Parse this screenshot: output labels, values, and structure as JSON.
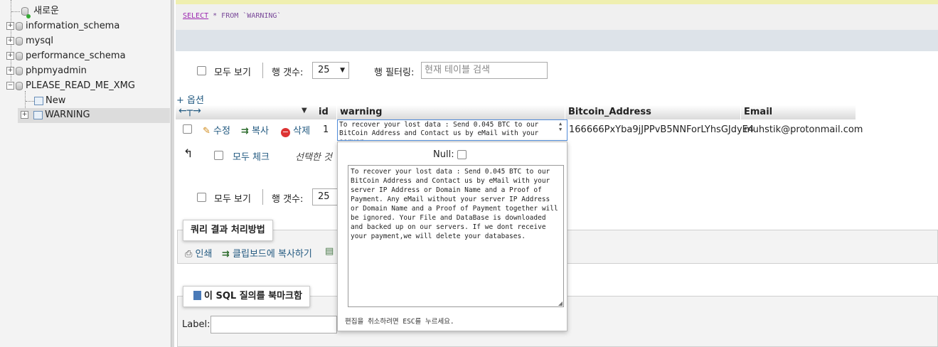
{
  "nav": {
    "items": [
      {
        "label": "새로운",
        "type": "new"
      },
      {
        "label": "information_schema",
        "type": "db"
      },
      {
        "label": "mysql",
        "type": "db"
      },
      {
        "label": "performance_schema",
        "type": "db"
      },
      {
        "label": "phpmyadmin",
        "type": "db"
      },
      {
        "label": "PLEASE_READ_ME_XMG",
        "type": "db-expanded"
      }
    ],
    "children": [
      {
        "label": "New"
      },
      {
        "label": "WARNING"
      }
    ]
  },
  "query": {
    "select_kw": "SELECT",
    "rest": " * FROM `WARNING`"
  },
  "controls_top": {
    "show_all": "모두 보기",
    "row_count_label": "행 갯수:",
    "row_count_value": "25",
    "filter_label": "행 필터링:",
    "filter_placeholder": "현재 테이블 검색"
  },
  "options_link": "+ 옵션",
  "table": {
    "columns": [
      "id",
      "warning",
      "Bitcoin_Address",
      "Email"
    ],
    "row": {
      "edit": "수정",
      "copy": "복사",
      "delete": "삭제",
      "id": "1",
      "warning_preview": "To recover your lost data : Send 0.045 BTC to our BitCoin Address and Contact us by eMail with your server",
      "bitcoin": "166666PxYba9jJPPvB5NNForLYhsGJdyE4",
      "email": "muhstik@protonmail.com"
    }
  },
  "bulk": {
    "check_all": "모두 체크",
    "with_selected": "선택한 것"
  },
  "controls_bottom": {
    "show_all": "모두 보기",
    "row_count_label": "행 갯수:",
    "row_count_value": "25"
  },
  "editor": {
    "null_label": "Null:",
    "full_text": "To recover your lost data : Send 0.045 BTC to our BitCoin Address and Contact us by eMail with your server IP Address or Domain Name and a Proof of Payment. Any eMail without your server IP Address or Domain Name and a Proof of Payment together will be ignored. Your File and DataBase is downloaded and backed up on our servers. If we dont receive your payment,we will delete your databases.",
    "hint": "편집을 취소하려면 ESC를 누르세요."
  },
  "query_ops": {
    "title": "쿼리 결과 처리방법",
    "print": "인쇄",
    "copy_clipboard": "클립보드에 복사하기"
  },
  "bookmark": {
    "title": "이 SQL 질의를 북마크함",
    "label": "Label:"
  }
}
